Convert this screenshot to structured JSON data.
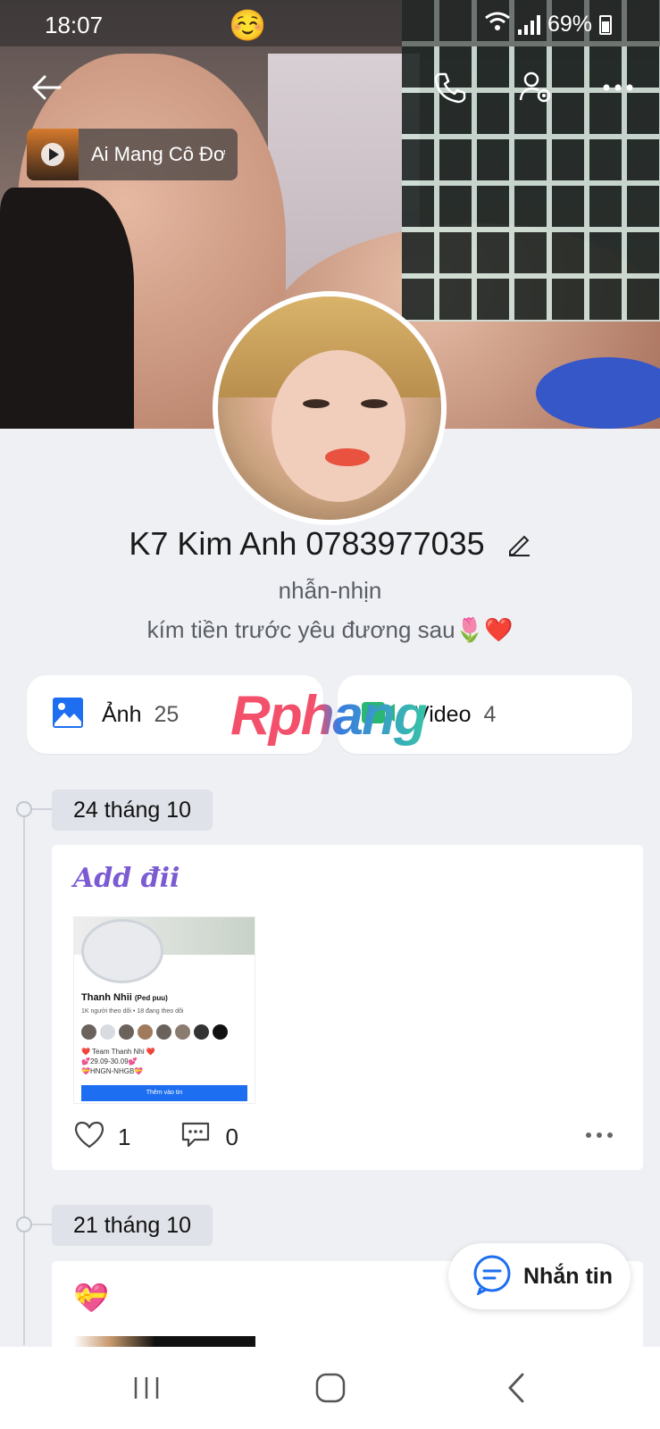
{
  "status_bar": {
    "time": "18:07",
    "emoji": "☺️",
    "battery": "69%"
  },
  "music": {
    "title": "Ai Mang Cô Đơn"
  },
  "profile": {
    "name": "K7 Kim Anh 0783977035",
    "nickname": "nhẫn-nhịn",
    "bio": "kím tiền trước yêu đương sau🌷❤️"
  },
  "media": [
    {
      "label": "Ảnh",
      "count": "25"
    },
    {
      "label": "Video",
      "count": "4"
    }
  ],
  "watermark": "Rphang",
  "timeline": [
    {
      "date": "24 tháng 10",
      "title": "Add đii",
      "image": {
        "name": "Thanh Nhii",
        "name_suffix": "(Ped puu)",
        "stats": "1K người theo dõi • 18 đang theo dõi",
        "line1": "❤️ Team Thanh Nhi ❤️",
        "line2": "💕29.09-30.09💕",
        "line3": "💝HNGN-NHGB💝",
        "button": "Thêm vào tin"
      },
      "likes": "1",
      "comments": "0"
    },
    {
      "date": "21 tháng 10",
      "title": "💝"
    }
  ],
  "message_button": {
    "label": "Nhắn tin"
  },
  "colors": {
    "accent": "#1d6ef0",
    "post_title": "#7b5bd2",
    "background": "#eef0f4"
  }
}
